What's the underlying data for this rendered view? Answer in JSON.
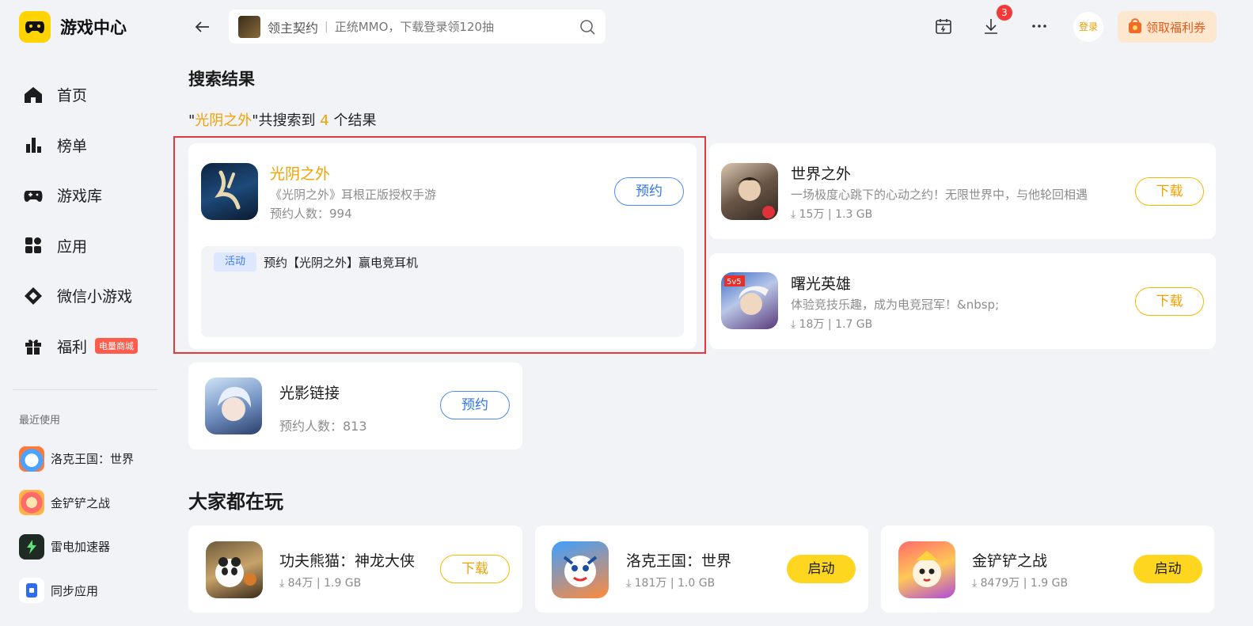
{
  "app": {
    "title": "游戏中心"
  },
  "sidebar": {
    "nav": [
      {
        "label": "首页",
        "icon": "home-icon"
      },
      {
        "label": "榜单",
        "icon": "rank-icon"
      },
      {
        "label": "游戏库",
        "icon": "gamepad-icon"
      },
      {
        "label": "应用",
        "icon": "apps-icon"
      },
      {
        "label": "微信小游戏",
        "icon": "wechat-game-icon"
      },
      {
        "label": "福利",
        "icon": "gift-icon",
        "badge": "电量商城"
      }
    ],
    "recent_title": "最近使用",
    "recent": [
      {
        "label": "洛克王国：世界"
      },
      {
        "label": "金铲铲之战"
      },
      {
        "label": "雷电加速器"
      },
      {
        "label": "同步应用"
      }
    ]
  },
  "topbar": {
    "search_game": "领主契约",
    "search_desc": "正统MMO，下载登录领120抽",
    "download_badge": "3",
    "login_label": "登录",
    "coupon_label": "领取福利券"
  },
  "results": {
    "title": "搜索结果",
    "quote_open": "\"",
    "query": "光阴之外",
    "quote_close": "\"共搜索到 ",
    "count": "4",
    "suffix": " 个结果",
    "items": [
      {
        "name": "光阴之外",
        "desc": "《光阴之外》耳根正版授权手游",
        "meta": "预约人数：994",
        "button": "预约",
        "activity_tag": "活动",
        "activity_text": "预约【光阴之外】赢电竞耳机"
      },
      {
        "name": "世界之外",
        "desc": "一场极度心跳下的心动之约！无限世界中，与他轮回相遇",
        "downloads": "15万",
        "size": "1.3 GB",
        "button": "下载"
      },
      {
        "name": "曙光英雄",
        "desc": "体验竞技乐趣，成为电竞冠军！&nbsp;",
        "downloads": "18万",
        "size": "1.7 GB",
        "button": "下载"
      },
      {
        "name": "光影链接",
        "meta": "预约人数：813",
        "button": "预约"
      }
    ]
  },
  "popular": {
    "title": "大家都在玩",
    "items": [
      {
        "name": "功夫熊猫：神龙大侠",
        "downloads": "84万",
        "size": "1.9 GB",
        "button": "下载"
      },
      {
        "name": "洛克王国：世界",
        "downloads": "181万",
        "size": "1.0 GB",
        "button": "启动"
      },
      {
        "name": "金铲铲之战",
        "downloads": "8479万",
        "size": "1.9 GB",
        "button": "启动"
      }
    ]
  },
  "colors": {
    "accent": "#ffd400",
    "highlight": "#f2a100",
    "reserve_blue": "#2f74f2",
    "badge_red": "#f23a3a"
  }
}
